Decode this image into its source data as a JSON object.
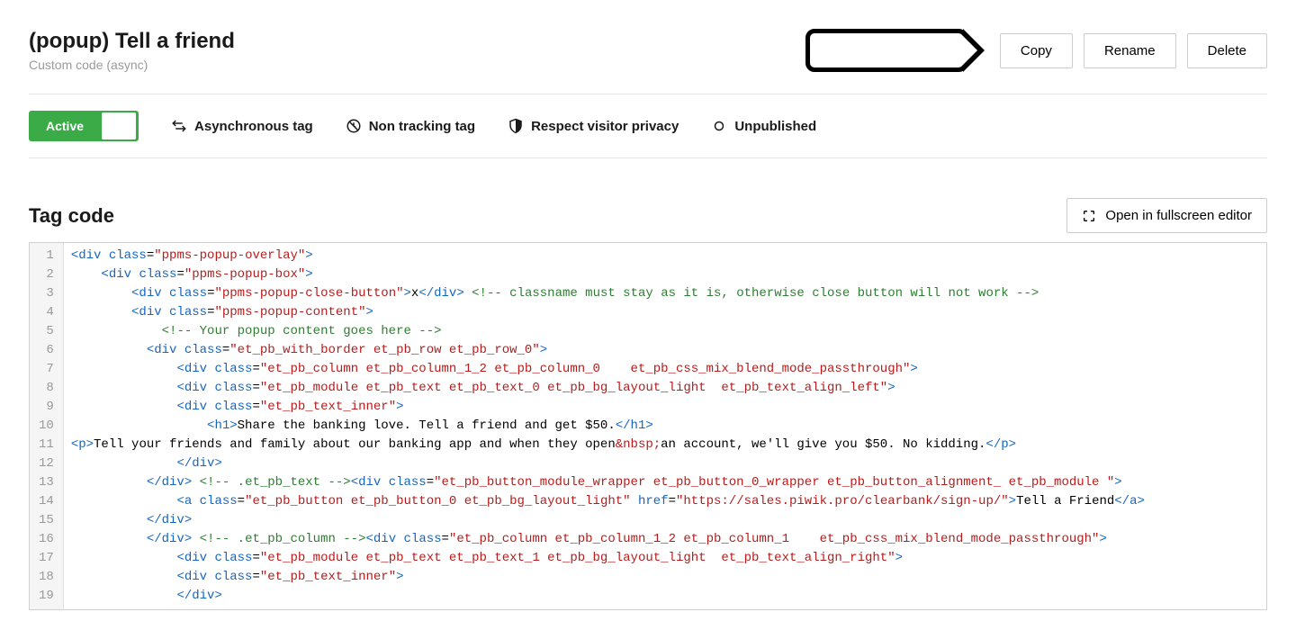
{
  "header": {
    "title": "(popup) Tell a friend",
    "subtitle": "Custom code (async)",
    "actions": {
      "copy": "Copy",
      "rename": "Rename",
      "delete": "Delete"
    }
  },
  "status": {
    "active_label": "Active",
    "meta": [
      {
        "icon": "swap-icon",
        "label": "Asynchronous tag"
      },
      {
        "icon": "no-tracking-icon",
        "label": "Non tracking tag"
      },
      {
        "icon": "shield-icon",
        "label": "Respect visitor privacy"
      },
      {
        "icon": "circle-icon",
        "label": "Unpublished"
      }
    ]
  },
  "section": {
    "title": "Tag code",
    "fullscreen_label": "Open in fullscreen editor"
  },
  "code": {
    "lines": [
      [
        {
          "t": "tag",
          "v": "<div"
        },
        {
          "t": "text",
          "v": " "
        },
        {
          "t": "attr",
          "v": "class"
        },
        {
          "t": "text",
          "v": "="
        },
        {
          "t": "str",
          "v": "\"ppms-popup-overlay\""
        },
        {
          "t": "tag",
          "v": ">"
        }
      ],
      [
        {
          "t": "text",
          "v": "    "
        },
        {
          "t": "tag",
          "v": "<div"
        },
        {
          "t": "text",
          "v": " "
        },
        {
          "t": "attr",
          "v": "class"
        },
        {
          "t": "text",
          "v": "="
        },
        {
          "t": "str",
          "v": "\"ppms-popup-box\""
        },
        {
          "t": "tag",
          "v": ">"
        }
      ],
      [
        {
          "t": "text",
          "v": "        "
        },
        {
          "t": "tag",
          "v": "<div"
        },
        {
          "t": "text",
          "v": " "
        },
        {
          "t": "attr",
          "v": "class"
        },
        {
          "t": "text",
          "v": "="
        },
        {
          "t": "str",
          "v": "\"ppms-popup-close-button\""
        },
        {
          "t": "tag",
          "v": ">"
        },
        {
          "t": "text",
          "v": "x"
        },
        {
          "t": "tag",
          "v": "</div>"
        },
        {
          "t": "text",
          "v": " "
        },
        {
          "t": "comment",
          "v": "<!-- classname must stay as it is, otherwise close button will not work -->"
        }
      ],
      [
        {
          "t": "text",
          "v": "        "
        },
        {
          "t": "tag",
          "v": "<div"
        },
        {
          "t": "text",
          "v": " "
        },
        {
          "t": "attr",
          "v": "class"
        },
        {
          "t": "text",
          "v": "="
        },
        {
          "t": "str",
          "v": "\"ppms-popup-content\""
        },
        {
          "t": "tag",
          "v": ">"
        }
      ],
      [
        {
          "t": "text",
          "v": "            "
        },
        {
          "t": "comment",
          "v": "<!-- Your popup content goes here -->"
        }
      ],
      [
        {
          "t": "text",
          "v": "          "
        },
        {
          "t": "tag",
          "v": "<div"
        },
        {
          "t": "text",
          "v": " "
        },
        {
          "t": "attr",
          "v": "class"
        },
        {
          "t": "text",
          "v": "="
        },
        {
          "t": "str",
          "v": "\"et_pb_with_border et_pb_row et_pb_row_0\""
        },
        {
          "t": "tag",
          "v": ">"
        }
      ],
      [
        {
          "t": "text",
          "v": "              "
        },
        {
          "t": "tag",
          "v": "<div"
        },
        {
          "t": "text",
          "v": " "
        },
        {
          "t": "attr",
          "v": "class"
        },
        {
          "t": "text",
          "v": "="
        },
        {
          "t": "str",
          "v": "\"et_pb_column et_pb_column_1_2 et_pb_column_0    et_pb_css_mix_blend_mode_passthrough\""
        },
        {
          "t": "tag",
          "v": ">"
        }
      ],
      [
        {
          "t": "text",
          "v": "              "
        },
        {
          "t": "tag",
          "v": "<div"
        },
        {
          "t": "text",
          "v": " "
        },
        {
          "t": "attr",
          "v": "class"
        },
        {
          "t": "text",
          "v": "="
        },
        {
          "t": "str",
          "v": "\"et_pb_module et_pb_text et_pb_text_0 et_pb_bg_layout_light  et_pb_text_align_left\""
        },
        {
          "t": "tag",
          "v": ">"
        }
      ],
      [
        {
          "t": "text",
          "v": "              "
        },
        {
          "t": "tag",
          "v": "<div"
        },
        {
          "t": "text",
          "v": " "
        },
        {
          "t": "attr",
          "v": "class"
        },
        {
          "t": "text",
          "v": "="
        },
        {
          "t": "str",
          "v": "\"et_pb_text_inner\""
        },
        {
          "t": "tag",
          "v": ">"
        }
      ],
      [
        {
          "t": "text",
          "v": "                  "
        },
        {
          "t": "tag",
          "v": "<h1>"
        },
        {
          "t": "text",
          "v": "Share the banking love. Tell a friend and get $50."
        },
        {
          "t": "tag",
          "v": "</h1>"
        }
      ],
      [
        {
          "t": "tag",
          "v": "<p>"
        },
        {
          "t": "text",
          "v": "Tell your friends and family about our banking app and when they open"
        },
        {
          "t": "entity",
          "v": "&nbsp;"
        },
        {
          "t": "text",
          "v": "an account, we'll give you $50. No kidding."
        },
        {
          "t": "tag",
          "v": "</p>"
        }
      ],
      [
        {
          "t": "text",
          "v": "              "
        },
        {
          "t": "tag",
          "v": "</div>"
        }
      ],
      [
        {
          "t": "text",
          "v": "          "
        },
        {
          "t": "tag",
          "v": "</div>"
        },
        {
          "t": "text",
          "v": " "
        },
        {
          "t": "comment",
          "v": "<!-- .et_pb_text -->"
        },
        {
          "t": "tag",
          "v": "<div"
        },
        {
          "t": "text",
          "v": " "
        },
        {
          "t": "attr",
          "v": "class"
        },
        {
          "t": "text",
          "v": "="
        },
        {
          "t": "str",
          "v": "\"et_pb_button_module_wrapper et_pb_button_0_wrapper et_pb_button_alignment_ et_pb_module \""
        },
        {
          "t": "tag",
          "v": ">"
        }
      ],
      [
        {
          "t": "text",
          "v": "              "
        },
        {
          "t": "tag",
          "v": "<a"
        },
        {
          "t": "text",
          "v": " "
        },
        {
          "t": "attr",
          "v": "class"
        },
        {
          "t": "text",
          "v": "="
        },
        {
          "t": "str",
          "v": "\"et_pb_button et_pb_button_0 et_pb_bg_layout_light\""
        },
        {
          "t": "text",
          "v": " "
        },
        {
          "t": "attr",
          "v": "href"
        },
        {
          "t": "text",
          "v": "="
        },
        {
          "t": "str",
          "v": "\"https://sales.piwik.pro/clearbank/sign-up/\""
        },
        {
          "t": "tag",
          "v": ">"
        },
        {
          "t": "text",
          "v": "Tell a Friend"
        },
        {
          "t": "tag",
          "v": "</a>"
        }
      ],
      [
        {
          "t": "text",
          "v": "          "
        },
        {
          "t": "tag",
          "v": "</div>"
        }
      ],
      [
        {
          "t": "text",
          "v": "          "
        },
        {
          "t": "tag",
          "v": "</div>"
        },
        {
          "t": "text",
          "v": " "
        },
        {
          "t": "comment",
          "v": "<!-- .et_pb_column -->"
        },
        {
          "t": "tag",
          "v": "<div"
        },
        {
          "t": "text",
          "v": " "
        },
        {
          "t": "attr",
          "v": "class"
        },
        {
          "t": "text",
          "v": "="
        },
        {
          "t": "str",
          "v": "\"et_pb_column et_pb_column_1_2 et_pb_column_1    et_pb_css_mix_blend_mode_passthrough\""
        },
        {
          "t": "tag",
          "v": ">"
        }
      ],
      [
        {
          "t": "text",
          "v": "              "
        },
        {
          "t": "tag",
          "v": "<div"
        },
        {
          "t": "text",
          "v": " "
        },
        {
          "t": "attr",
          "v": "class"
        },
        {
          "t": "text",
          "v": "="
        },
        {
          "t": "str",
          "v": "\"et_pb_module et_pb_text et_pb_text_1 et_pb_bg_layout_light  et_pb_text_align_right\""
        },
        {
          "t": "tag",
          "v": ">"
        }
      ],
      [
        {
          "t": "text",
          "v": "              "
        },
        {
          "t": "tag",
          "v": "<div"
        },
        {
          "t": "text",
          "v": " "
        },
        {
          "t": "attr",
          "v": "class"
        },
        {
          "t": "text",
          "v": "="
        },
        {
          "t": "str",
          "v": "\"et_pb_text_inner\""
        },
        {
          "t": "tag",
          "v": ">"
        }
      ],
      [
        {
          "t": "text",
          "v": "              "
        },
        {
          "t": "tag",
          "v": "</div>"
        }
      ]
    ]
  }
}
